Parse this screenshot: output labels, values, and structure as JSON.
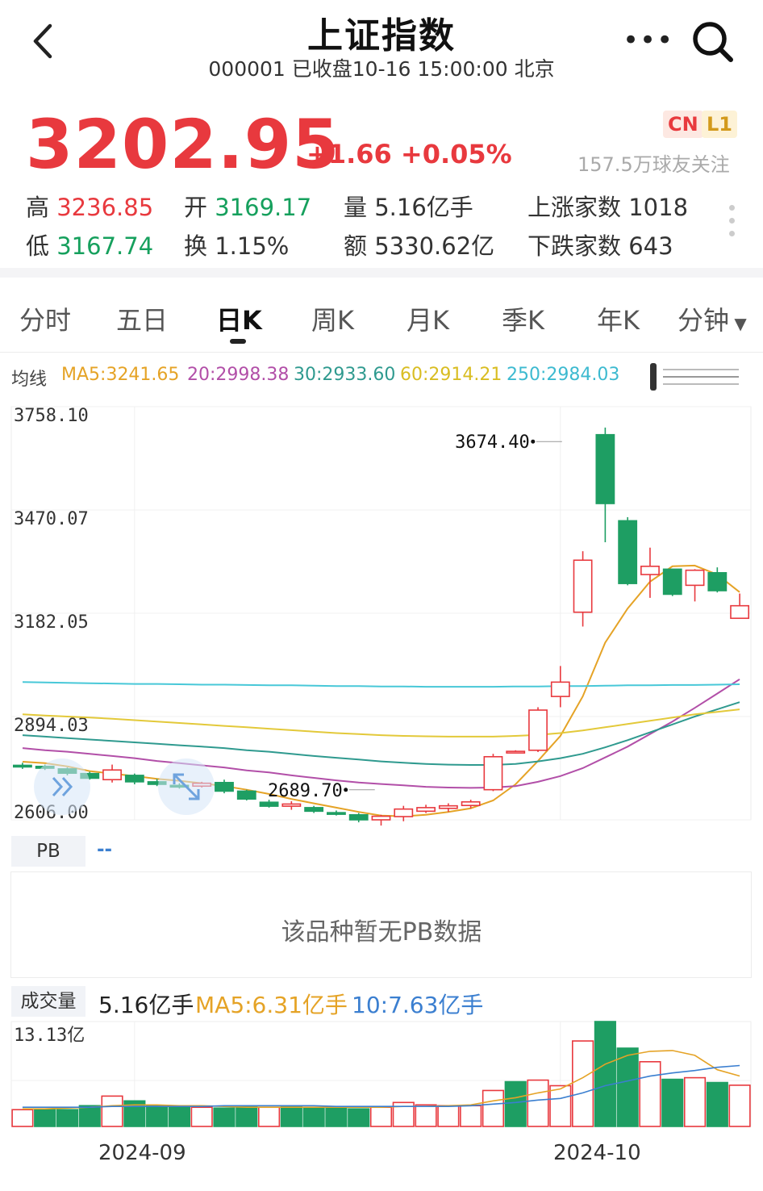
{
  "header": {
    "title": "上证指数",
    "subtitle": "000001 已收盘10-16 15:00:00 北京"
  },
  "quote": {
    "price": "3202.95",
    "change": "+1.66 +0.05%",
    "badge_cn": "CN",
    "badge_l1": "L1",
    "followers": "157.5万球友关注"
  },
  "stats": {
    "high_label": "高",
    "high": "3236.85",
    "low_label": "低",
    "low": "3167.74",
    "open_label": "开",
    "open": "3169.17",
    "turnover_label": "换",
    "turnover": "1.15%",
    "volume_label": "量",
    "volume": "5.16亿手",
    "amount_label": "额",
    "amount": "5330.62亿",
    "up_label": "上涨家数",
    "up": "1018",
    "down_label": "下跌家数",
    "down": "643"
  },
  "tabs": [
    "分时",
    "五日",
    "日K",
    "周K",
    "月K",
    "季K",
    "年K",
    "分钟"
  ],
  "active_tab": "日K",
  "ma_legend": {
    "label": "均线",
    "ma5": "MA5:3241.65",
    "ma20": "20:2998.38",
    "ma30": "30:2933.60",
    "ma60": "60:2914.21",
    "ma250": "250:2984.03"
  },
  "colors": {
    "up": "#e8393e",
    "down": "#1e9e63",
    "ma5": "#e5a326",
    "ma20": "#b24fa8",
    "ma30": "#2f9a8f",
    "ma60": "#e3c93a",
    "ma250": "#48c8d8",
    "vol_ma10": "#3b7fd0"
  },
  "icons": {
    "back": "chevron-left-icon",
    "more": "more-dots-icon",
    "search": "search-icon",
    "forward": "double-chevron-icon",
    "expand": "expand-icon"
  },
  "chart_data": [
    {
      "type": "candlestick",
      "yticks": [
        "3758.10",
        "3470.07",
        "3182.05",
        "2894.03",
        "2606.00"
      ],
      "ylim": [
        2606.0,
        3758.1
      ],
      "grid": true,
      "annotations": [
        {
          "label": "3674.40",
          "index": 24,
          "value": 3674.4
        },
        {
          "label": "2689.70",
          "index": 15,
          "value": 2689.7
        }
      ],
      "candles": [
        {
          "o": 2758,
          "h": 2765,
          "l": 2748,
          "c": 2755
        },
        {
          "o": 2755,
          "h": 2760,
          "l": 2745,
          "c": 2750
        },
        {
          "o": 2748,
          "h": 2752,
          "l": 2730,
          "c": 2736
        },
        {
          "o": 2735,
          "h": 2740,
          "l": 2718,
          "c": 2722
        },
        {
          "o": 2718,
          "h": 2760,
          "l": 2710,
          "c": 2745
        },
        {
          "o": 2730,
          "h": 2735,
          "l": 2705,
          "c": 2712
        },
        {
          "o": 2712,
          "h": 2720,
          "l": 2700,
          "c": 2705
        },
        {
          "o": 2702,
          "h": 2708,
          "l": 2693,
          "c": 2698
        },
        {
          "o": 2700,
          "h": 2712,
          "l": 2696,
          "c": 2708
        },
        {
          "o": 2710,
          "h": 2718,
          "l": 2680,
          "c": 2686
        },
        {
          "o": 2686,
          "h": 2690,
          "l": 2660,
          "c": 2664
        },
        {
          "o": 2655,
          "h": 2662,
          "l": 2640,
          "c": 2644
        },
        {
          "o": 2644,
          "h": 2658,
          "l": 2634,
          "c": 2650
        },
        {
          "o": 2640,
          "h": 2645,
          "l": 2625,
          "c": 2630
        },
        {
          "o": 2626,
          "h": 2632,
          "l": 2618,
          "c": 2622
        },
        {
          "o": 2620,
          "h": 2625,
          "l": 2599,
          "c": 2606
        },
        {
          "o": 2606,
          "h": 2620,
          "l": 2590,
          "c": 2616
        },
        {
          "o": 2615,
          "h": 2645,
          "l": 2602,
          "c": 2636
        },
        {
          "o": 2630,
          "h": 2648,
          "l": 2625,
          "c": 2640
        },
        {
          "o": 2638,
          "h": 2652,
          "l": 2628,
          "c": 2645
        },
        {
          "o": 2646,
          "h": 2662,
          "l": 2638,
          "c": 2656
        },
        {
          "o": 2690,
          "h": 2790,
          "l": 2686,
          "c": 2782
        },
        {
          "o": 2795,
          "h": 2800,
          "l": 2793,
          "c": 2797
        },
        {
          "o": 2800,
          "h": 2920,
          "l": 2795,
          "c": 2912
        },
        {
          "o": 2950,
          "h": 3035,
          "l": 2920,
          "c": 2990
        },
        {
          "o": 3185,
          "h": 3355,
          "l": 3145,
          "c": 3330
        },
        {
          "o": 3680,
          "h": 3700,
          "l": 3380,
          "c": 3488
        },
        {
          "o": 3440,
          "h": 3450,
          "l": 3260,
          "c": 3265
        },
        {
          "o": 3290,
          "h": 3365,
          "l": 3225,
          "c": 3313
        },
        {
          "o": 3305,
          "h": 3306,
          "l": 3230,
          "c": 3235
        },
        {
          "o": 3260,
          "h": 3305,
          "l": 3215,
          "c": 3302
        },
        {
          "o": 3295,
          "h": 3310,
          "l": 3240,
          "c": 3245
        },
        {
          "o": 3168,
          "h": 3237,
          "l": 3167,
          "c": 3203
        }
      ],
      "ma": [
        {
          "name": "MA5",
          "values": [
            2768,
            2764,
            2755,
            2742,
            2735,
            2728,
            2720,
            2715,
            2708,
            2700,
            2690,
            2678,
            2664,
            2652,
            2640,
            2628,
            2618,
            2616,
            2620,
            2628,
            2638,
            2660,
            2705,
            2770,
            2840,
            2950,
            3100,
            3195,
            3270,
            3313,
            3315,
            3290,
            3241
          ]
        },
        {
          "name": "20",
          "values": [
            2806,
            2800,
            2796,
            2790,
            2784,
            2778,
            2770,
            2764,
            2758,
            2752,
            2744,
            2738,
            2730,
            2723,
            2716,
            2710,
            2706,
            2702,
            2698,
            2696,
            2695,
            2696,
            2700,
            2712,
            2728,
            2750,
            2780,
            2810,
            2845,
            2880,
            2918,
            2958,
            2998
          ]
        },
        {
          "name": "30",
          "values": [
            2842,
            2838,
            2834,
            2830,
            2826,
            2822,
            2818,
            2814,
            2810,
            2806,
            2800,
            2796,
            2790,
            2784,
            2779,
            2774,
            2769,
            2765,
            2762,
            2760,
            2759,
            2759,
            2762,
            2769,
            2778,
            2790,
            2808,
            2828,
            2850,
            2872,
            2894,
            2914,
            2934
          ]
        },
        {
          "name": "60",
          "values": [
            2900,
            2897,
            2894,
            2891,
            2888,
            2884,
            2880,
            2876,
            2872,
            2868,
            2864,
            2860,
            2856,
            2852,
            2848,
            2845,
            2842,
            2840,
            2839,
            2838,
            2838,
            2838,
            2840,
            2843,
            2848,
            2855,
            2864,
            2873,
            2882,
            2891,
            2900,
            2907,
            2914
          ]
        },
        {
          "name": "250",
          "values": [
            2990,
            2989,
            2988,
            2987,
            2986,
            2985,
            2985,
            2984,
            2983,
            2983,
            2982,
            2981,
            2981,
            2980,
            2979,
            2979,
            2978,
            2978,
            2977,
            2977,
            2977,
            2977,
            2978,
            2978,
            2979,
            2979,
            2980,
            2981,
            2981,
            2982,
            2982,
            2983,
            2984
          ]
        }
      ]
    },
    {
      "type": "bar",
      "title": "成交量",
      "ytick": "13.13亿",
      "ylim": [
        0,
        13.13
      ],
      "current": "5.16亿手",
      "ma5": "MA5:6.31亿手",
      "ma10": "10:7.63亿手",
      "xticks": [
        {
          "label": "2024-09",
          "index": 5
        },
        {
          "label": "2024-10",
          "index": 24
        }
      ],
      "values": [
        2.1,
        2.1,
        2.1,
        2.6,
        3.8,
        3.2,
        2.6,
        2.5,
        2.4,
        2.3,
        2.5,
        2.4,
        2.5,
        2.3,
        2.3,
        2.2,
        2.4,
        3.0,
        2.7,
        2.6,
        2.6,
        4.5,
        5.6,
        5.8,
        5.1,
        10.7,
        13.13,
        9.8,
        8.1,
        5.9,
        6.1,
        5.5,
        5.16
      ],
      "up": [
        true,
        false,
        false,
        false,
        true,
        false,
        false,
        false,
        true,
        false,
        false,
        true,
        false,
        false,
        false,
        false,
        true,
        true,
        true,
        true,
        true,
        true,
        false,
        true,
        true,
        true,
        false,
        false,
        true,
        false,
        true,
        false,
        true
      ],
      "ma5_series": [
        2.2,
        2.2,
        2.3,
        2.4,
        2.6,
        2.7,
        2.7,
        2.6,
        2.6,
        2.5,
        2.4,
        2.4,
        2.4,
        2.4,
        2.4,
        2.4,
        2.4,
        2.5,
        2.5,
        2.6,
        2.7,
        3.2,
        3.6,
        4.2,
        4.7,
        6.1,
        7.8,
        8.9,
        9.4,
        9.5,
        8.9,
        7.1,
        6.31
      ],
      "ma10_series": [
        2.4,
        2.4,
        2.4,
        2.4,
        2.5,
        2.5,
        2.5,
        2.5,
        2.5,
        2.6,
        2.6,
        2.6,
        2.6,
        2.6,
        2.5,
        2.5,
        2.5,
        2.5,
        2.5,
        2.5,
        2.6,
        2.8,
        3.0,
        3.3,
        3.5,
        4.2,
        5.1,
        5.7,
        6.3,
        6.7,
        7.0,
        7.4,
        7.63
      ]
    }
  ],
  "pb": {
    "label": "PB",
    "value": "--",
    "message": "该品种暂无PB数据"
  }
}
